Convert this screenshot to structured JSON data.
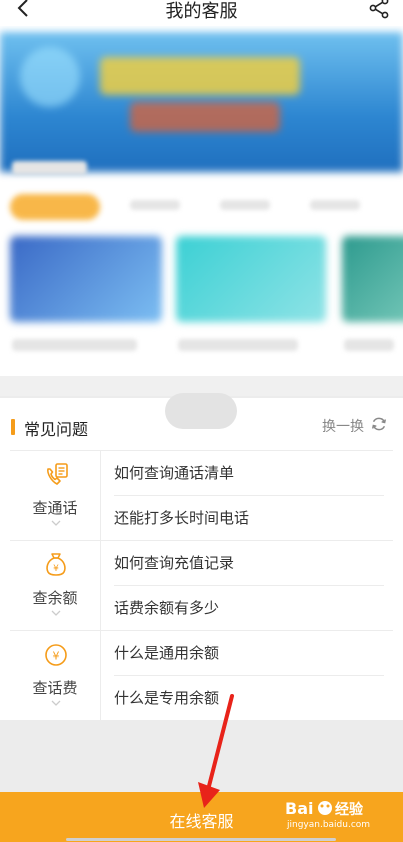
{
  "header": {
    "title": "我的客服",
    "back_icon": "chevron-left-icon",
    "share_icon": "share-icon"
  },
  "faq": {
    "title": "常见问题",
    "refresh_label": "换一换",
    "refresh_icon": "refresh-icon",
    "accent": "#f59c1a",
    "groups": [
      {
        "name": "查通话",
        "icon": "phone-list-icon",
        "questions": [
          "如何查询通话清单",
          "还能打多长时间电话"
        ]
      },
      {
        "name": "查余额",
        "icon": "money-bag-icon",
        "questions": [
          "如何查询充值记录",
          "话费余额有多少"
        ]
      },
      {
        "name": "查话费",
        "icon": "yuan-coin-icon",
        "questions": [
          "什么是通用余额",
          "什么是专用余额"
        ]
      }
    ]
  },
  "bottom": {
    "cta_label": "在线客服",
    "bar_color": "#f7a51e"
  },
  "watermark": {
    "brand": "Bai du 经验",
    "url": "jingyan.baidu.com"
  },
  "annotation": {
    "arrow_color": "#e8231a"
  }
}
